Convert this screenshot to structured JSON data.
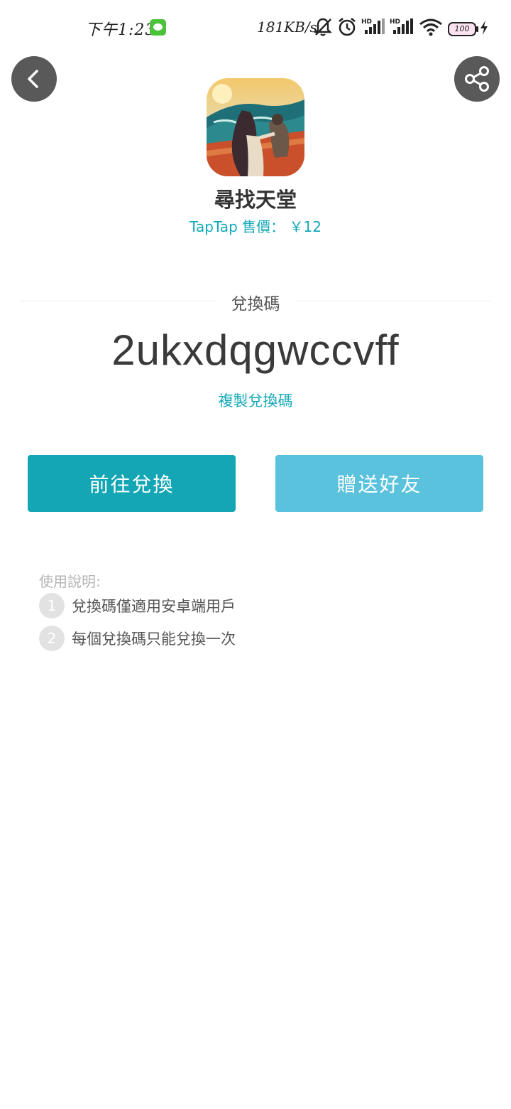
{
  "status_bar": {
    "time": "下午1:23",
    "net_speed": "181KB/s",
    "battery": "100"
  },
  "icons": {
    "back": "back-arrow-icon",
    "share": "share-icon"
  },
  "game": {
    "title": "尋找天堂",
    "price": "TapTap 售價： ￥12"
  },
  "code": {
    "label": "兌換碼",
    "value": "2ukxdqgwccvff",
    "copy_label": "複製兌換碼"
  },
  "actions": {
    "redeem_label": "前往兌換",
    "gift_label": "贈送好友"
  },
  "instructions": {
    "title": "使用說明:",
    "items": [
      {
        "num": "1",
        "text": "兌換碼僅適用安卓端用戶"
      },
      {
        "num": "2",
        "text": "每個兌換碼只能兌換一次"
      }
    ]
  },
  "colors": {
    "accent": "#14a9b8",
    "redeem_button": "#14a6b4",
    "gift_button": "#5bc2de",
    "round_button": "#595959"
  }
}
